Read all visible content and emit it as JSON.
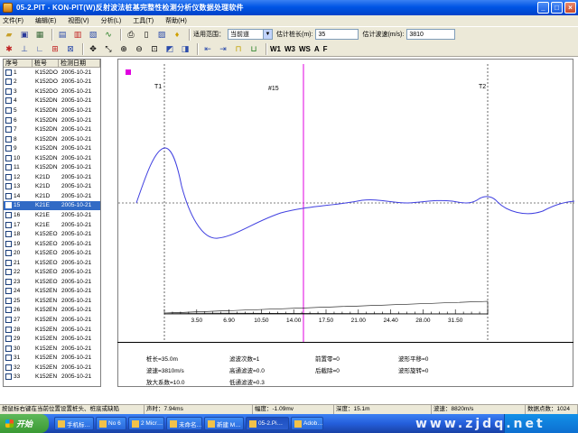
{
  "window": {
    "title": "05-2.PIT - KON-PIT(W)反射波法桩基完整性检测分析仪数据处理软件"
  },
  "menu": [
    "文件(F)",
    "编辑(E)",
    "视图(V)",
    "分析(L)",
    "工具(T)",
    "帮助(H)"
  ],
  "toolbar": {
    "range_label": "适用范围：",
    "range_value": "当前道",
    "pile_length_label": "估计桩长(m):",
    "pile_length_value": "35",
    "wave_speed_label": "估计波速(m/s):",
    "wave_speed_value": "3810",
    "text_buttons": [
      "W1",
      "W3",
      "WS",
      "A",
      "F"
    ]
  },
  "list": {
    "headers": [
      "序号",
      "桩号",
      "检测日期"
    ],
    "rows": [
      {
        "no": "1",
        "pile": "K152DO",
        "date": "2005-10-21"
      },
      {
        "no": "2",
        "pile": "K152DO",
        "date": "2005-10-21"
      },
      {
        "no": "3",
        "pile": "K152DO",
        "date": "2005-10-21"
      },
      {
        "no": "4",
        "pile": "K152DN",
        "date": "2005-10-21"
      },
      {
        "no": "5",
        "pile": "K152DN",
        "date": "2005-10-21"
      },
      {
        "no": "6",
        "pile": "K152DN",
        "date": "2005-10-21"
      },
      {
        "no": "7",
        "pile": "K152DN",
        "date": "2005-10-21"
      },
      {
        "no": "8",
        "pile": "K152DN",
        "date": "2005-10-21"
      },
      {
        "no": "9",
        "pile": "K152DN",
        "date": "2005-10-21"
      },
      {
        "no": "10",
        "pile": "K152DN",
        "date": "2005-10-21"
      },
      {
        "no": "11",
        "pile": "K152DN",
        "date": "2005-10-21"
      },
      {
        "no": "12",
        "pile": "K21D",
        "date": "2005-10-21"
      },
      {
        "no": "13",
        "pile": "K21D",
        "date": "2005-10-21"
      },
      {
        "no": "14",
        "pile": "K21D",
        "date": "2005-10-21"
      },
      {
        "no": "15",
        "pile": "K21E",
        "date": "2005-10-21"
      },
      {
        "no": "16",
        "pile": "K21E",
        "date": "2005-10-21"
      },
      {
        "no": "17",
        "pile": "K21E",
        "date": "2005-10-21"
      },
      {
        "no": "18",
        "pile": "K152EO",
        "date": "2005-10-21"
      },
      {
        "no": "19",
        "pile": "K152EO",
        "date": "2005-10-21"
      },
      {
        "no": "20",
        "pile": "K152EO",
        "date": "2005-10-21"
      },
      {
        "no": "21",
        "pile": "K152EO",
        "date": "2005-10-21"
      },
      {
        "no": "22",
        "pile": "K152EO",
        "date": "2005-10-21"
      },
      {
        "no": "23",
        "pile": "K152EO",
        "date": "2005-10-21"
      },
      {
        "no": "24",
        "pile": "K152EN",
        "date": "2005-10-21"
      },
      {
        "no": "25",
        "pile": "K152EN",
        "date": "2005-10-21"
      },
      {
        "no": "26",
        "pile": "K152EN",
        "date": "2005-10-21"
      },
      {
        "no": "27",
        "pile": "K152EN",
        "date": "2005-10-21"
      },
      {
        "no": "28",
        "pile": "K152EN",
        "date": "2005-10-21"
      },
      {
        "no": "29",
        "pile": "K152EN",
        "date": "2005-10-21"
      },
      {
        "no": "30",
        "pile": "K152EN",
        "date": "2005-10-21"
      },
      {
        "no": "31",
        "pile": "K152EN",
        "date": "2005-10-21"
      },
      {
        "no": "32",
        "pile": "K152EN",
        "date": "2005-10-21"
      },
      {
        "no": "33",
        "pile": "K152EN",
        "date": "2005-10-21"
      }
    ],
    "selected_row": "15"
  },
  "waveform": {
    "label_t1": "T1",
    "label_t2": "T2",
    "label_cursor": "#15",
    "cursor_color": "#e000e0",
    "wave_color": "#4040e0",
    "scale_ticks": [
      "3.50",
      "6.90",
      "10.50",
      "14.00",
      "17.50",
      "21.00",
      "24.40",
      "28.00",
      "31.50"
    ]
  },
  "info": {
    "pile_length": "桩长=35.0m",
    "wave_speed": "波速=3810m/s",
    "amplification": "放大系数=10.0",
    "filter_count": "滤波次数=1",
    "highpass": "高通滤波=0.0",
    "lowpass": "低通滤波=0.3",
    "pre_zero": "前置零=0",
    "post_cut": "后截除=0",
    "wave_shift": "波形平移=0",
    "wave_rotate": "波形旋转=0"
  },
  "status": {
    "hint": "按鼠标右键在当前位置设置桩头、桩底或缺陷",
    "time": "声时：7.94ms",
    "amplitude": "幅度：-1.09mv",
    "depth": "深度：15.1m",
    "speed": "波速：8820m/s",
    "points": "数据点数：1024"
  },
  "taskbar": {
    "start": "开始",
    "tasks": [
      "手机标…",
      "No 6",
      "2 Micr…",
      "未命名…",
      "新建 M…",
      "05-2.Pi…",
      "Adob…"
    ],
    "active_task": "05-2.Pi…",
    "watermark": "www.zjdq.net"
  }
}
